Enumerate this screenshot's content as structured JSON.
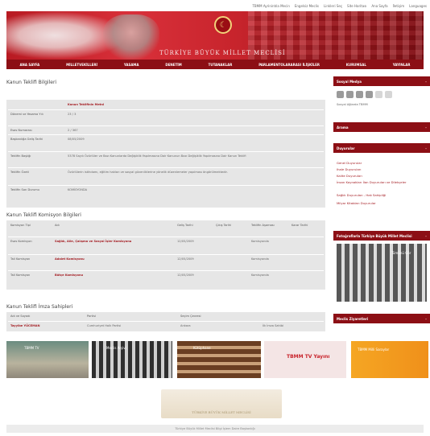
{
  "topbar": {
    "links": [
      "TBMM Ayrinintıla Mecin",
      "Engelsiz Meclis",
      "Linkleri Seç",
      "Site Haritası",
      "Ana Sayfa",
      "İletişim",
      "Languages"
    ]
  },
  "banner": {
    "title": "TÜRKİYE BÜYÜK MİLLET MECLİSİ"
  },
  "nav": {
    "items": [
      "ANA SAYFA",
      "MİLLETVEKİLLERİ",
      "YASAMA",
      "DENETİM",
      "TUTANAKLAR",
      "PARLAMENTOLARARASI İLİŞKİLER",
      "KURUMSAL",
      "YAYINLAR"
    ]
  },
  "bill": {
    "heading": "Kanun Teklifi Bilgileri",
    "subheading": "Kanun Teklifinin Metni",
    "rows": [
      {
        "label": "Dönemi ve Yasama Yılı",
        "value": "23 / 3"
      },
      {
        "label": "Esas Numarası",
        "value": "2 / 367"
      },
      {
        "label": "Başkanlığa Geliş Tarihi",
        "value": "08/05/2009"
      },
      {
        "label": "Teklifin Başlığı",
        "value": "5378 Sayılı Özürlüler ve Bazı Kanunlarda Değişiklik Yapılmasına Dair Kanunun Bazı Değişiklik Yapılmasına Dair Kanun Teklifi"
      },
      {
        "label": "Teklifin Özeti",
        "value": "Özürlülerin istihdamı, eğitim hakları ve sosyal güvenliklerine yönelik düzenlemeler yapılması öngörülmektedir."
      },
      {
        "label": "Teklifin Son Durumu",
        "value": "KOMİSYONDA"
      }
    ]
  },
  "commission": {
    "heading": "Kanun Teklifi Komisyon Bilgileri",
    "columns": [
      "Komisyon Tipi",
      "Adı",
      "Geliş Tarihi",
      "Çıkış Tarihi",
      "Teklifin Aşaması",
      "Karar Tarihi"
    ],
    "rows": [
      {
        "type": "Esas Komisyon",
        "name": "Sağlık, Aile, Çalışma ve Sosyal İşler Komisyonu",
        "date": "12/05/2009",
        "stage": "Komisyonda"
      },
      {
        "type": "Tali Komisyon",
        "name": "Adalet Komisyonu",
        "date": "12/05/2009",
        "stage": "Komisyonda"
      },
      {
        "type": "Tali Komisyon",
        "name": "Bütçe Komisyonu",
        "date": "12/05/2009",
        "stage": "Komisyonda"
      }
    ]
  },
  "sponsor": {
    "heading": "Kanun Teklifi İmza Sahipleri",
    "columns": [
      "Adı ve Soyadı",
      "Partisi",
      "Seçim Çevresi",
      ""
    ],
    "row": {
      "name": "Tayyibe YÜCEMAN",
      "party": "Cumhuriyet Halk Partisi",
      "city": "Ankara",
      "role": "İlk İmza Sahibi"
    }
  },
  "sidebar": {
    "social_heading": "Sosyal Medya",
    "social_text": "Sosyal Ağlarda TBMM",
    "search_heading": "Arama",
    "links_heading": "Duyurular",
    "links": [
      "Genel Duyurular",
      "Ihale Duyuruları",
      "Kalite Duyuruları",
      "İnsan Kaynakları İlan Duyuruları ve Dilekçeler",
      "Sağlık Duyuruları - Hak Sahipliği",
      "Milyar Kitabları Duyurular"
    ],
    "gallery_heading": "Fotoğraflarla Türkiye Büyük Millet Meclisi",
    "gallery_caption": "Tümünü Gör",
    "more_heading": "Meclis Ziyaretleri"
  },
  "thumbs": [
    {
      "label": "TBMM TV"
    },
    {
      "label": "Meclis Arşivi"
    },
    {
      "label": "Kütüphane"
    },
    {
      "label": "TBMM TV Yayını"
    },
    {
      "label": "TBMM Milli Saraylar"
    }
  ],
  "logo_text": "TÜRKİYE BÜYÜK MİLLET MECLİSİ",
  "footer": {
    "text": "Türkiye Büyük Millet Meclisi Bilgi İşlem Daire Başkanlığı"
  },
  "colors": {
    "brand": "#8c0f15",
    "link": "#a41c22",
    "panel": "#e6e6e6"
  }
}
